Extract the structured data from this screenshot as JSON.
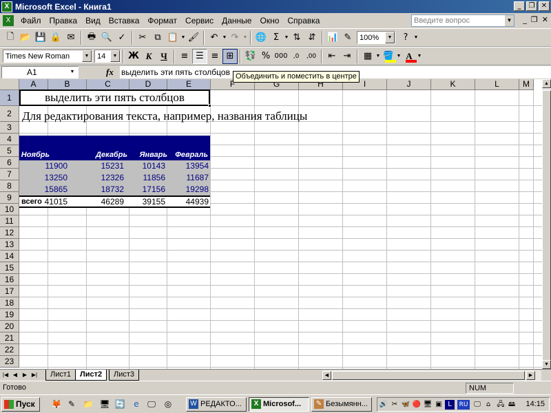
{
  "window": {
    "title": "Microsoft Excel - Книга1",
    "app_icon": "excel-icon"
  },
  "menu": {
    "items": [
      "Файл",
      "Правка",
      "Вид",
      "Вставка",
      "Формат",
      "Сервис",
      "Данные",
      "Окно",
      "Справка"
    ],
    "help_placeholder": "Введите вопрос"
  },
  "toolbar": {
    "zoom": "100%",
    "font_name": "Times New Roman",
    "font_size": "14",
    "bold_label": "Ж",
    "italic_label": "К",
    "underline_label": "Ч",
    "percent_label": "%",
    "thousands_label": "000",
    "font_color": "#ff0000",
    "fill_color": "#ffff00"
  },
  "formula_bar": {
    "cell_ref": "A1",
    "fx_label": "fx",
    "content": "выделить эти пять столбцов"
  },
  "tooltip": "Объединить и поместить в центре",
  "grid": {
    "columns": [
      "A",
      "B",
      "C",
      "D",
      "E",
      "F",
      "G",
      "H",
      "I",
      "J",
      "K",
      "L",
      "M"
    ],
    "rows": [
      "1",
      "2",
      "3",
      "4",
      "5",
      "6",
      "7",
      "8",
      "9",
      "10",
      "11",
      "12",
      "13",
      "14",
      "15",
      "16",
      "17",
      "18",
      "19",
      "20",
      "21",
      "22",
      "23"
    ]
  },
  "cells": {
    "a1": "выделить эти пять столбцов",
    "a2": "Для редактирования текста, например, названия таблицы"
  },
  "table": {
    "headers": [
      "Ноябрь",
      "Декабрь",
      "Январь",
      "Февраль"
    ],
    "rows": [
      [
        "11900",
        "15231",
        "10143",
        "13954"
      ],
      [
        "13250",
        "12326",
        "11856",
        "11687"
      ],
      [
        "15865",
        "18732",
        "17156",
        "19298"
      ]
    ],
    "total_label": "всего",
    "totals": [
      "41015",
      "46289",
      "39155",
      "44939"
    ],
    "header_bg": "#000080",
    "body_bg": "#c0c0c0"
  },
  "sheets": {
    "tabs": [
      "Лист1",
      "Лист2",
      "Лист3"
    ],
    "active": "Лист2"
  },
  "status": {
    "text": "Готово",
    "num": "NUM"
  },
  "taskbar": {
    "start": "Пуск",
    "tasks": [
      "РЕДАКТО...",
      "Microsof...",
      "Безымянн..."
    ],
    "lang": "RU",
    "clock": "14:15"
  }
}
